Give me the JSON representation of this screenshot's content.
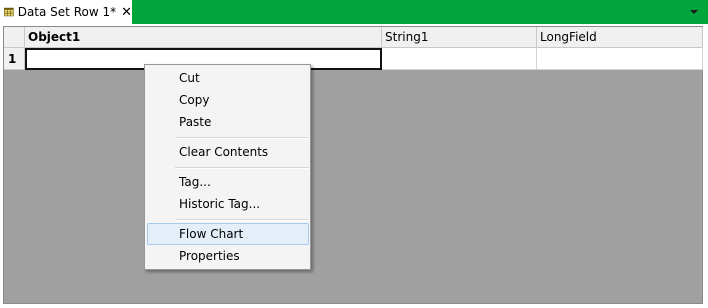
{
  "tab": {
    "title": "Data Set Row 1*",
    "close_glyph": "✕",
    "icon": "table-icon"
  },
  "grid": {
    "columns": [
      {
        "label": "Object1",
        "bold": true
      },
      {
        "label": "String1",
        "bold": false
      },
      {
        "label": "LongField",
        "bold": false
      }
    ],
    "rows": [
      {
        "index": "1",
        "cells": [
          "",
          "",
          ""
        ]
      }
    ]
  },
  "context_menu": {
    "items": [
      {
        "label": "Cut"
      },
      {
        "label": "Copy"
      },
      {
        "label": "Paste"
      },
      {
        "label": "Clear Contents"
      },
      {
        "label": "Tag..."
      },
      {
        "label": "Historic Tag..."
      },
      {
        "label": "Flow Chart",
        "highlighted": true
      },
      {
        "label": "Properties"
      }
    ]
  },
  "colors": {
    "tabstrip": "#00a53c",
    "grid_background": "#a0a0a0",
    "menu_highlight": "#e4eef9"
  }
}
